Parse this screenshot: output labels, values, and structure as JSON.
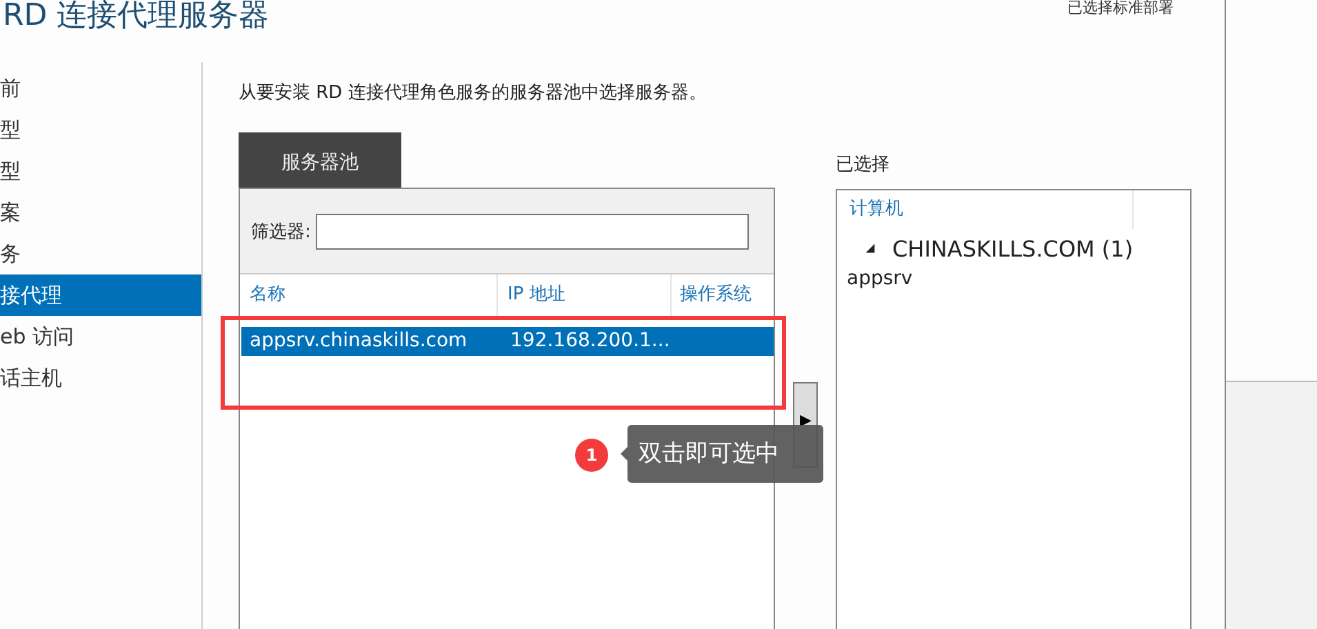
{
  "header": {
    "title": "RD 连接代理服务器",
    "deployment": "已选择标准部署"
  },
  "sidebar": {
    "items": [
      {
        "label": "前",
        "selected": false
      },
      {
        "label": "型",
        "selected": false
      },
      {
        "label": "型",
        "selected": false
      },
      {
        "label": "案",
        "selected": false
      },
      {
        "label": "务",
        "selected": false
      },
      {
        "label": "接代理",
        "selected": true
      },
      {
        "label": "eb 访问",
        "selected": false
      },
      {
        "label": "话主机",
        "selected": false
      }
    ]
  },
  "instruction": "从要安装 RD 连接代理角色服务的服务器池中选择服务器。",
  "pool": {
    "tab": {
      "label": "服务器池",
      "selected": true
    },
    "filter": {
      "label": "筛选器:"
    },
    "columns": [
      "名称",
      "IP 地址",
      "操作系统"
    ],
    "rows": [
      {
        "cells": [
          "appsrv.chinaskills.com",
          "192.168.200.1..."
        ],
        "selected": true
      }
    ]
  },
  "add_button": {
    "label": "▶"
  },
  "selected": {
    "title": "已选择",
    "column": "计算机",
    "groups": [
      {
        "label": "CHINASKILLS.COM (1)",
        "expanded": true,
        "children": [
          {
            "label": "appsrv"
          }
        ]
      }
    ]
  },
  "annotation": {
    "badge": "1",
    "text": "双击即可选中"
  }
}
